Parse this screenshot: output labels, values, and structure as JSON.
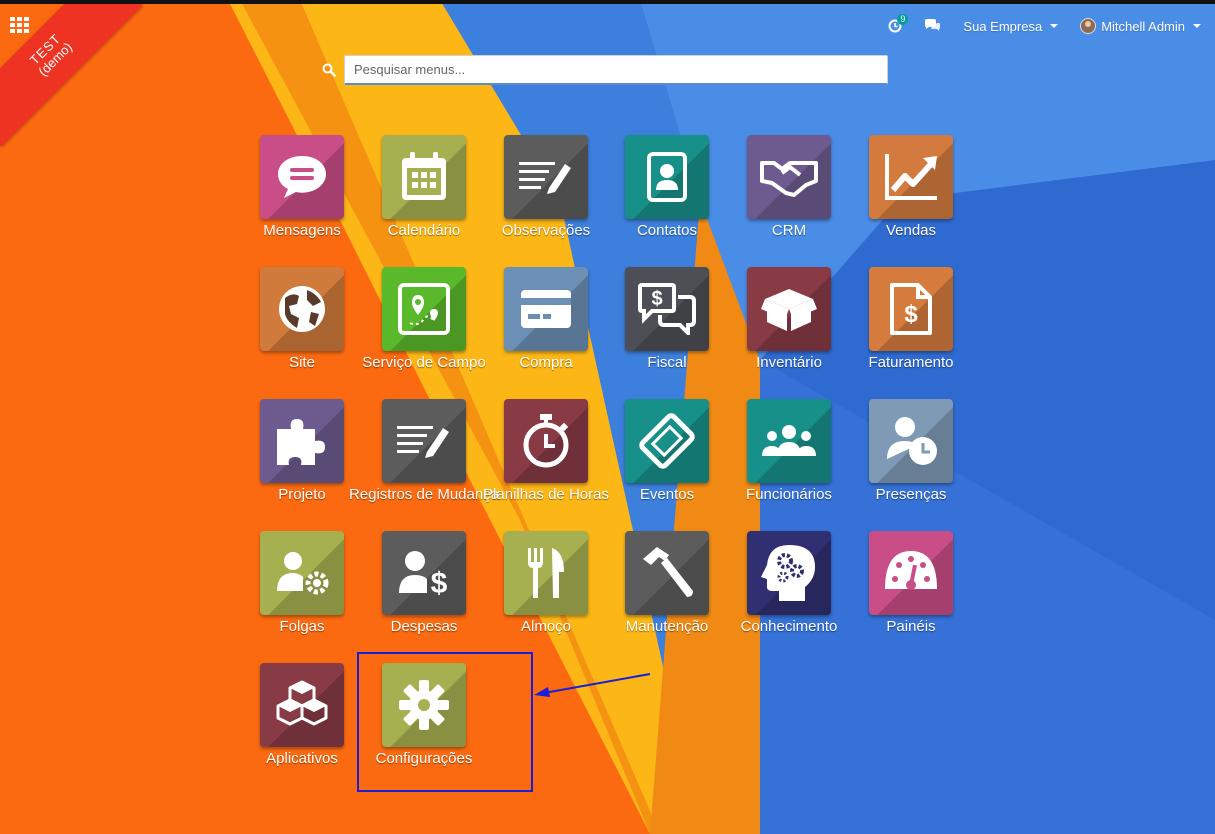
{
  "env_ribbon": {
    "line1": "TEST",
    "line2": "(demo)"
  },
  "nav": {
    "activity_count": "9",
    "company": "Sua Empresa",
    "user": "Mitchell Admin"
  },
  "search": {
    "placeholder": "Pesquisar menus..."
  },
  "apps": [
    {
      "label": "Mensagens",
      "icon": "chat-icon",
      "color": "#c94d86"
    },
    {
      "label": "Calendário",
      "icon": "calendar-icon",
      "color": "#a7b050"
    },
    {
      "label": "Observações",
      "icon": "notes-icon",
      "color": "#5c5c5c"
    },
    {
      "label": "Contatos",
      "icon": "contact-card-icon",
      "color": "#17908a"
    },
    {
      "label": "CRM",
      "icon": "handshake-icon",
      "color": "#6d5b8f"
    },
    {
      "label": "Vendas",
      "icon": "chart-up-icon",
      "color": "#d37b3e"
    },
    {
      "label": "Site",
      "icon": "globe-icon",
      "color": "#d07a3b"
    },
    {
      "label": "Serviço de Campo",
      "icon": "map-icon",
      "color": "#5ab82b"
    },
    {
      "label": "Compra",
      "icon": "credit-card-icon",
      "color": "#6b8fb5"
    },
    {
      "label": "Fiscal",
      "icon": "money-chat-icon",
      "color": "#4e4e57"
    },
    {
      "label": "Inventário",
      "icon": "box-icon",
      "color": "#883b45"
    },
    {
      "label": "Faturamento",
      "icon": "invoice-icon",
      "color": "#d57b3d"
    },
    {
      "label": "Projeto",
      "icon": "puzzle-icon",
      "color": "#6d5b8f"
    },
    {
      "label": "Registros de Mudança",
      "icon": "notes-icon",
      "color": "#5c5c5c"
    },
    {
      "label": "Planilhas de Horas",
      "icon": "stopwatch-icon",
      "color": "#883b45"
    },
    {
      "label": "Eventos",
      "icon": "ticket-icon",
      "color": "#17908a"
    },
    {
      "label": "Funcionários",
      "icon": "people-icon",
      "color": "#17908a"
    },
    {
      "label": "Presenças",
      "icon": "user-clock-icon",
      "color": "#7e9ab5"
    },
    {
      "label": "Folgas",
      "icon": "user-gear-icon",
      "color": "#a7b050"
    },
    {
      "label": "Despesas",
      "icon": "user-dollar-icon",
      "color": "#5c5c5c"
    },
    {
      "label": "Almoço",
      "icon": "cutlery-icon",
      "color": "#a7b050"
    },
    {
      "label": "Manutenção",
      "icon": "hammer-icon",
      "color": "#5c5c5c"
    },
    {
      "label": "Conhecimento",
      "icon": "brain-gears-icon",
      "color": "#2f2f72"
    },
    {
      "label": "Painéis",
      "icon": "gauge-icon",
      "color": "#c94d86"
    },
    {
      "label": "Aplicativos",
      "icon": "cubes-icon",
      "color": "#883b45"
    },
    {
      "label": "Configurações",
      "icon": "gear-icon",
      "color": "#a7b050"
    }
  ],
  "annotation": {
    "box_color": "#1a1fd6",
    "arrow_color": "#1a1fd6"
  }
}
